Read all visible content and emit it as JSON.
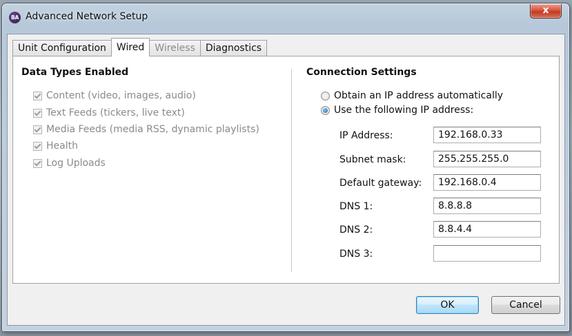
{
  "window": {
    "title": "Advanced Network Setup",
    "icon_text": "BA",
    "close_glyph": "x"
  },
  "tabs": [
    {
      "label": "Unit Configuration",
      "state": "normal"
    },
    {
      "label": "Wired",
      "state": "active"
    },
    {
      "label": "Wireless",
      "state": "disabled"
    },
    {
      "label": "Diagnostics",
      "state": "normal"
    }
  ],
  "data_types": {
    "title": "Data Types Enabled",
    "items": [
      {
        "label": "Content (video, images, audio)",
        "checked": true,
        "enabled": false
      },
      {
        "label": "Text Feeds (tickers, live text)",
        "checked": true,
        "enabled": false
      },
      {
        "label": "Media Feeds (media RSS, dynamic playlists)",
        "checked": true,
        "enabled": false
      },
      {
        "label": "Health",
        "checked": true,
        "enabled": false
      },
      {
        "label": "Log Uploads",
        "checked": true,
        "enabled": false
      }
    ]
  },
  "connection": {
    "title": "Connection Settings",
    "options": [
      {
        "label": "Obtain an IP address automatically",
        "selected": false
      },
      {
        "label": "Use the following IP address:",
        "selected": true
      }
    ],
    "fields": [
      {
        "label": "IP Address:",
        "value": "192.168.0.33"
      },
      {
        "label": "Subnet mask:",
        "value": "255.255.255.0"
      },
      {
        "label": "Default gateway:",
        "value": "192.168.0.4"
      },
      {
        "label": "DNS 1:",
        "value": "8.8.8.8"
      },
      {
        "label": "DNS 2:",
        "value": "8.8.4.4"
      },
      {
        "label": "DNS 3:",
        "value": ""
      }
    ]
  },
  "buttons": {
    "ok": "OK",
    "cancel": "Cancel"
  }
}
